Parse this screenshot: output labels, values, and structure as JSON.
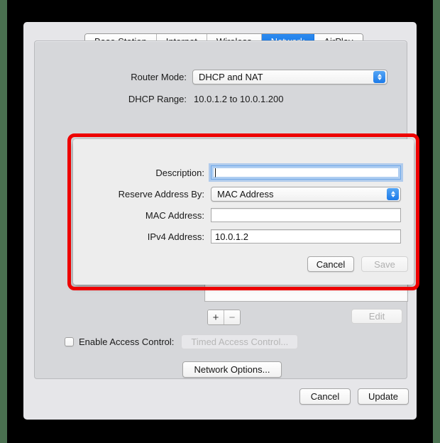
{
  "window": {
    "tabs": [
      {
        "label": "Base Station",
        "active": false
      },
      {
        "label": "Internet",
        "active": false
      },
      {
        "label": "Wireless",
        "active": false
      },
      {
        "label": "Network",
        "active": true
      },
      {
        "label": "AirPlay",
        "active": false
      }
    ],
    "router_mode": {
      "label": "Router Mode:",
      "value": "DHCP and NAT"
    },
    "dhcp_range": {
      "label": "DHCP Range:",
      "value": "10.0.1.2 to 10.0.1.200"
    },
    "list_controls": {
      "add_label": "+",
      "remove_label": "−",
      "edit_label": "Edit"
    },
    "access_control": {
      "checkbox_label": "Enable Access Control:",
      "checked": false,
      "timed_button_label": "Timed Access Control..."
    },
    "network_options_label": "Network Options...",
    "footer": {
      "cancel_label": "Cancel",
      "update_label": "Update"
    }
  },
  "sheet": {
    "description": {
      "label": "Description:",
      "value": "",
      "focused": true
    },
    "reserve_address_by": {
      "label": "Reserve Address By:",
      "value": "MAC Address"
    },
    "mac_address": {
      "label": "MAC Address:",
      "value": ""
    },
    "ipv4_address": {
      "label": "IPv4 Address:",
      "value": "10.0.1.2"
    },
    "cancel_label": "Cancel",
    "save_label": "Save",
    "save_enabled": false
  },
  "annotation": {
    "highlight_color": "#ee0000"
  }
}
